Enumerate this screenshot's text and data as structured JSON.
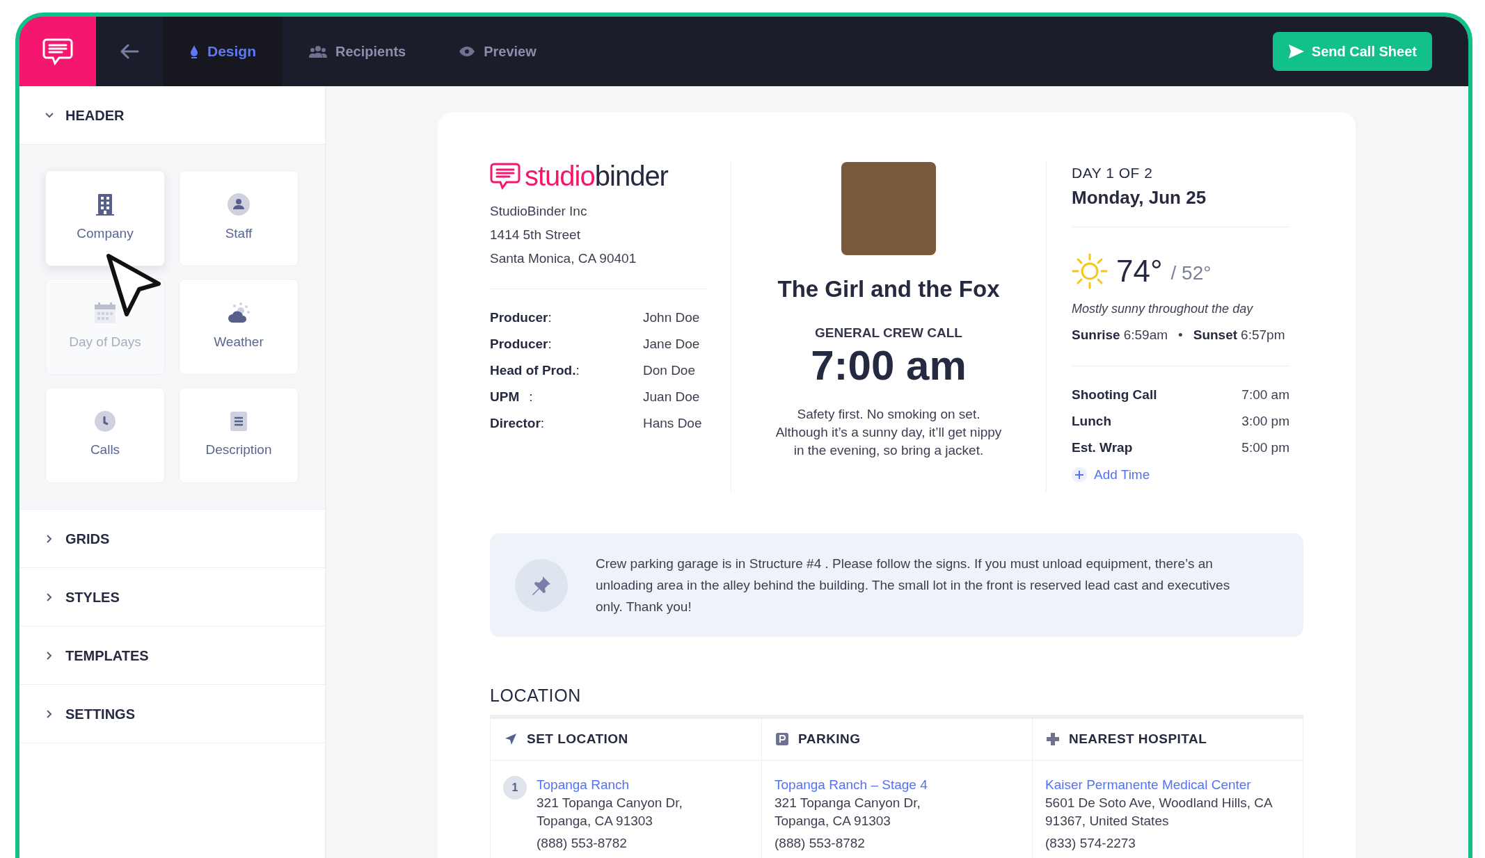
{
  "topbar": {
    "tabs": [
      {
        "label": "Design",
        "selected": true,
        "kind": "drop"
      },
      {
        "label": "Recipients",
        "selected": false,
        "kind": "people"
      },
      {
        "label": "Preview",
        "selected": false,
        "kind": "eye"
      }
    ],
    "send_button": "Send Call Sheet"
  },
  "sidebar": {
    "header": {
      "label": "HEADER",
      "expanded": true
    },
    "tiles": [
      {
        "label": "Company",
        "kind": "building",
        "selected": true,
        "disabled": false
      },
      {
        "label": "Staff",
        "kind": "person",
        "selected": false,
        "disabled": false
      },
      {
        "label": "Day of Days",
        "kind": "calendar",
        "selected": false,
        "disabled": true
      },
      {
        "label": "Weather",
        "kind": "cloud",
        "selected": false,
        "disabled": false
      },
      {
        "label": "Calls",
        "kind": "clock",
        "selected": false,
        "disabled": false
      },
      {
        "label": "Description",
        "kind": "doc",
        "selected": false,
        "disabled": false
      }
    ],
    "sections": [
      {
        "label": "GRIDS",
        "expanded": false
      },
      {
        "label": "STYLES",
        "expanded": false
      },
      {
        "label": "TEMPLATES",
        "expanded": false
      },
      {
        "label": "SETTINGS",
        "expanded": false
      }
    ]
  },
  "call_sheet": {
    "logo": {
      "part1": "studio",
      "part2": "binder"
    },
    "company": [
      "StudioBinder Inc",
      "1414 5th Street",
      "Santa Monica, CA 90401"
    ],
    "staff": [
      {
        "role": "Producer",
        "sep": ":",
        "name": "John Doe"
      },
      {
        "role": "Producer",
        "sep": ":",
        "name": "Jane Doe"
      },
      {
        "role": "Head of Prod.",
        "sep": ":",
        "name": "Don Doe"
      },
      {
        "role": "UPM",
        "sep": ":",
        "name": "Juan Doe"
      },
      {
        "role": "Director",
        "sep": ":",
        "name": "Hans Doe"
      }
    ],
    "title": "The Girl and the Fox",
    "crew_call_label": "GENERAL CREW CALL",
    "crew_call_time": "7:00 am",
    "description": "Safety first. No smoking on set. Although it’s a sunny day, it’ll get nippy in the evening, so bring a jacket.",
    "day": "DAY 1 OF 2",
    "date": "Monday, Jun 25",
    "weather": {
      "high": "74°",
      "low": "/ 52°",
      "summary": "Mostly sunny throughout the day",
      "sunrise_label": "Sunrise",
      "sunrise": "6:59am",
      "bullet": "•",
      "sunset_label": "Sunset",
      "sunset": "6:57pm"
    },
    "calls": [
      {
        "label": "Shooting Call",
        "time": "7:00 am"
      },
      {
        "label": "Lunch",
        "time": "3:00 pm"
      },
      {
        "label": "Est. Wrap",
        "time": "5:00 pm"
      }
    ],
    "add_time": "Add Time",
    "note": "Crew parking garage is in Structure #4 . Please follow the signs. If you must unload equipment, there’s an unloading area in the alley behind the building. The small lot in the front is reserved lead cast and executives only. Thank you!",
    "location": {
      "heading": "LOCATION",
      "columns": [
        {
          "title": "SET LOCATION",
          "kind": "arrow",
          "number": "1",
          "name": "Topanga Ranch",
          "address": [
            "321 Topanga Canyon Dr,",
            "Topanga, CA 91303"
          ],
          "phone": "(888) 553-8782"
        },
        {
          "title": "PARKING",
          "kind": "parking",
          "name": "Topanga Ranch – Stage 4",
          "address": [
            "321 Topanga Canyon Dr,",
            "Topanga, CA 91303"
          ],
          "phone": "(888) 553-8782"
        },
        {
          "title": "NEAREST HOSPITAL",
          "kind": "cross",
          "name": "Kaiser Permanente Medical Center",
          "address": [
            "5601 De Soto Ave, Woodland Hills, CA",
            "91367, United States"
          ],
          "phone": "(833) 574-2273"
        }
      ]
    }
  }
}
